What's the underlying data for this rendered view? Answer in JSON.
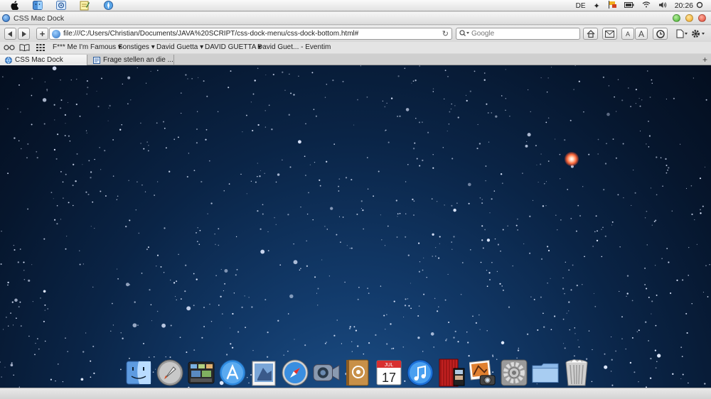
{
  "menubar": {
    "icons": [
      "apple-icon",
      "finder-icon",
      "mail-icon",
      "notes-icon",
      "safari-icon"
    ],
    "language": "DE",
    "clock": "20:26"
  },
  "window": {
    "title": "CSS Mac Dock"
  },
  "toolbar": {
    "url": "file:///C:/Users/Christian/Documents/JAVA%20SCRIPT/css-dock-menu/css-dock-bottom.html#",
    "search_placeholder": "Google",
    "font_small": "A",
    "font_large": "A"
  },
  "bookmarks": [
    {
      "label": "F*** Me I'm Famous",
      "dropdown": true
    },
    {
      "label": "Sonstiges",
      "dropdown": true
    },
    {
      "label": "David Guetta",
      "dropdown": true
    },
    {
      "label": "DAVID GUETTA",
      "dropdown": true
    },
    {
      "label": "David Guet... - Eventim",
      "dropdown": false
    }
  ],
  "tabs": [
    {
      "label": "CSS Mac Dock",
      "active": true
    },
    {
      "label": "Frage stellen an die ...",
      "active": false
    }
  ],
  "dock": {
    "items": [
      "finder-icon",
      "launchpad-icon",
      "mission-control-icon",
      "app-store-icon",
      "preview-icon",
      "safari-icon",
      "facetime-icon",
      "address-book-icon",
      "calendar-icon",
      "itunes-icon",
      "photo-booth-icon",
      "iphoto-icon",
      "system-preferences-icon",
      "folder-icon",
      "trash-icon"
    ],
    "calendar_month": "JUL",
    "calendar_day": "17"
  },
  "colors": {
    "space_dark": "#06162d",
    "space_light": "#1f5590",
    "red_star": "#ff6a3a"
  }
}
